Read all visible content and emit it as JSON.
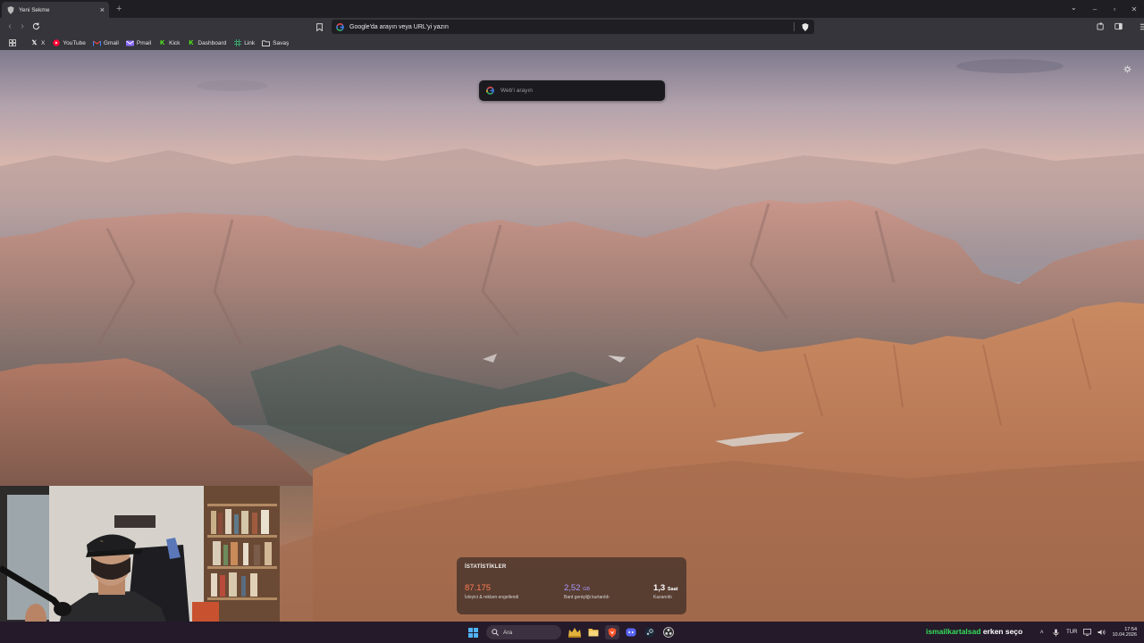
{
  "tab": {
    "title": "Yeni Sekme"
  },
  "toolbar": {
    "url_placeholder": "Google'da arayın veya URL'yi yazın"
  },
  "bookmarks": [
    {
      "label": "X",
      "icon": "x-logo-icon",
      "color": "#ffffff"
    },
    {
      "label": "YouTube",
      "icon": "youtube-icon",
      "color": "#ff0033"
    },
    {
      "label": "Gmail",
      "icon": "gmail-icon",
      "color": "#ea4335"
    },
    {
      "label": "Pmail",
      "icon": "pmail-icon",
      "color": "#8a6cff"
    },
    {
      "label": "Kick",
      "icon": "kick-icon",
      "color": "#53fc18"
    },
    {
      "label": "Dashboard",
      "icon": "kick-icon",
      "color": "#53fc18"
    },
    {
      "label": "Link",
      "icon": "grid-icon",
      "color": "#3aa36b"
    },
    {
      "label": "Savaş",
      "icon": "folder-icon",
      "color": "#d9d9d9"
    }
  ],
  "search": {
    "placeholder": "Web'i arayın"
  },
  "stats": {
    "heading": "İSTATİSTİKLER",
    "blocked": {
      "value": "87.175",
      "caption": "İzleyici & reklam engellendi",
      "color": "#ff7b52"
    },
    "bandwidth": {
      "value": "2,52",
      "unit": "GB",
      "caption": "Bant genişliği kurtarıldı",
      "color": "#a79bff"
    },
    "time": {
      "value": "1,3",
      "unit": "Saat",
      "caption": "Kazanıldı",
      "color": "#ffffff"
    }
  },
  "taskbar": {
    "search_label": "Ara",
    "ticker_name": "ismailkartalsad",
    "ticker_text": "erken seço",
    "language": "TUR",
    "time": "17:54",
    "date": "10.04.2026"
  }
}
